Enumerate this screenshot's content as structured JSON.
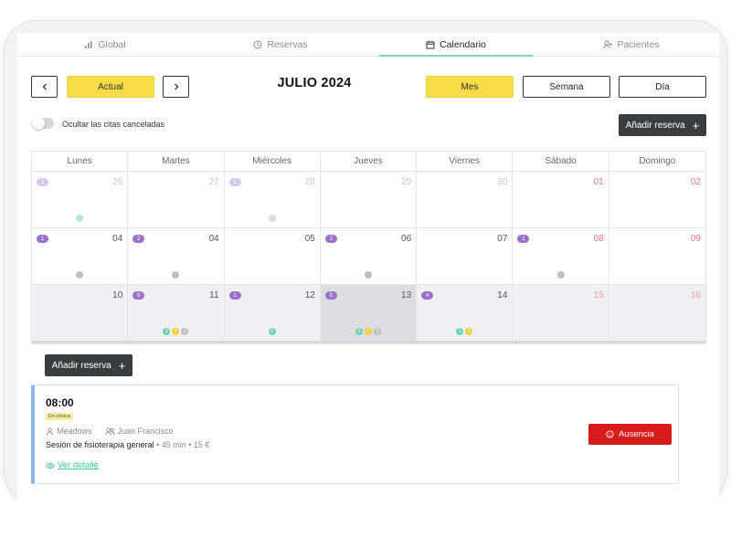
{
  "nav": {
    "tabs": [
      {
        "label": "Global",
        "icon": "bar-chart-icon"
      },
      {
        "label": "Reservas",
        "icon": "clock-icon"
      },
      {
        "label": "Calendario",
        "icon": "calendar-icon",
        "active": true
      },
      {
        "label": "Pacientes",
        "icon": "user-plus-icon"
      }
    ]
  },
  "toolbar": {
    "prev_icon": "chevron-left-icon",
    "today_label": "Actual",
    "next_icon": "chevron-right-icon",
    "month_title": "JULIO 2024",
    "views": [
      {
        "label": "Mes",
        "active": true
      },
      {
        "label": "Semana",
        "active": false
      },
      {
        "label": "Día",
        "active": false
      }
    ]
  },
  "filters": {
    "hide_cancelled_label": "Ocultar las citas canceladas",
    "hide_cancelled_on": false,
    "add_booking_label": "Añadir reserva"
  },
  "colors": {
    "accent_green": "#7fd3c2",
    "yellow": "#f7dc49",
    "purple": "#9b72c9",
    "dark_button": "#3a3d40",
    "absence_red": "#d81b1b",
    "dot_teal": "#6fd3b6",
    "dot_yellow": "#f3d13c",
    "dot_gray": "#bfbfbf"
  },
  "calendar": {
    "weekdays": [
      "Lunes",
      "Martes",
      "Miércoles",
      "Jueves",
      "Viernes",
      "Sábado",
      "Domingo"
    ],
    "weeks": [
      [
        {
          "day": "26",
          "style": "faded",
          "badge": "1",
          "badgeFaded": true,
          "dots": [
            {
              "c": "teal",
              "t": "",
              "faded": true
            }
          ]
        },
        {
          "day": "27",
          "style": "faded"
        },
        {
          "day": "28",
          "style": "faded",
          "badge": "1",
          "badgeFaded": true,
          "dots": [
            {
              "c": "gray",
              "t": "",
              "faded": true
            }
          ]
        },
        {
          "day": "29",
          "style": "faded"
        },
        {
          "day": "30",
          "style": "faded"
        },
        {
          "day": "01",
          "style": "red"
        },
        {
          "day": "02",
          "style": "red"
        }
      ],
      [
        {
          "day": "04",
          "badge": "1",
          "dots": [
            {
              "c": "gray",
              "t": ""
            }
          ]
        },
        {
          "day": "04",
          "badge": "2",
          "dots": [
            {
              "c": "gray",
              "t": ""
            }
          ]
        },
        {
          "day": "05"
        },
        {
          "day": "06",
          "badge": "2",
          "dots": [
            {
              "c": "gray",
              "t": ""
            }
          ]
        },
        {
          "day": "07"
        },
        {
          "day": "08",
          "style": "red",
          "badge": "1",
          "dots": [
            {
              "c": "gray",
              "t": ""
            }
          ]
        },
        {
          "day": "09",
          "style": "red"
        }
      ],
      [
        {
          "day": "10",
          "muted": true
        },
        {
          "day": "11",
          "muted": true,
          "badge": "5",
          "dots": [
            {
              "c": "teal",
              "t": "2"
            },
            {
              "c": "yellow",
              "t": "1"
            },
            {
              "c": "gray",
              "t": "2"
            }
          ]
        },
        {
          "day": "12",
          "muted": true,
          "badge": "1",
          "dots": [
            {
              "c": "teal",
              "t": "1"
            }
          ]
        },
        {
          "day": "13",
          "selected": true,
          "badge": "5",
          "dots": [
            {
              "c": "teal",
              "t": "2"
            },
            {
              "c": "yellow",
              "t": "1"
            },
            {
              "c": "gray",
              "t": "2"
            }
          ]
        },
        {
          "day": "14",
          "muted": true,
          "badge": "4",
          "dots": [
            {
              "c": "teal",
              "t": "1"
            },
            {
              "c": "yellow",
              "t": "3"
            }
          ]
        },
        {
          "day": "15",
          "muted": true,
          "style": "redfaded"
        },
        {
          "day": "16",
          "muted": true,
          "style": "redfaded"
        }
      ]
    ]
  },
  "day_panel": {
    "add_booking_label": "Añadir reserva",
    "appointment": {
      "time": "08:00",
      "tag": "En clínica",
      "professional": "Meadows",
      "patient": "Juan Francisco",
      "session": "Sesión de fisioterapia general",
      "meta": "• 45 min • 15 €",
      "details_label": "Ver detalle",
      "absence_label": "Ausencia"
    }
  }
}
